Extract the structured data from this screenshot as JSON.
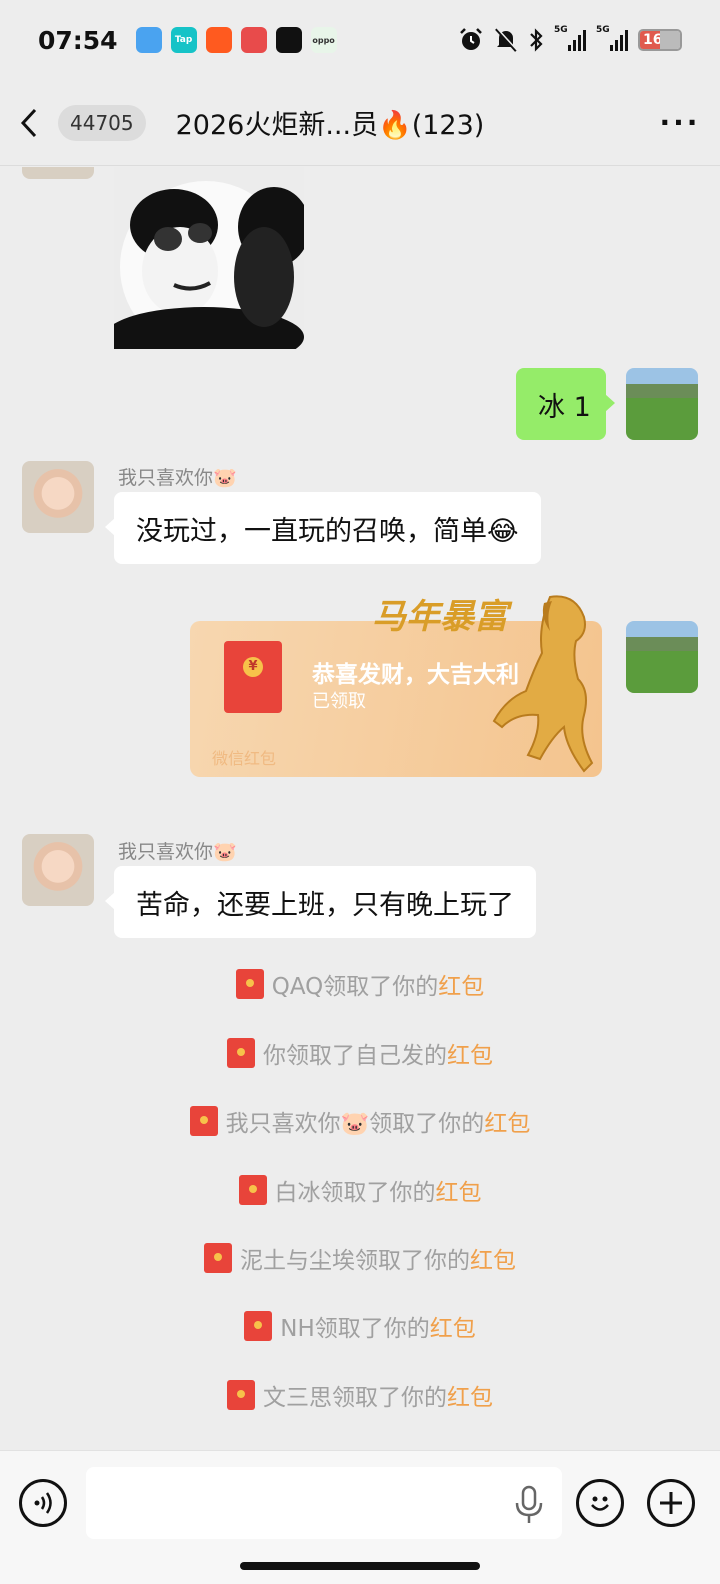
{
  "status": {
    "time": "07:54",
    "apps": [
      {
        "name": "paper-plane-app-icon",
        "label": "",
        "color": "#4aa3f0"
      },
      {
        "name": "taptap-app-icon",
        "label": "Tap",
        "color": "#16c3c7"
      },
      {
        "name": "kuaishou-app-icon",
        "label": "",
        "color": "#ff5a1f"
      },
      {
        "name": "game-app-icon",
        "label": "",
        "color": "#e84b4b"
      },
      {
        "name": "music-app-icon",
        "label": "",
        "color": "#111111"
      },
      {
        "name": "oppo-app-icon",
        "label": "oppo",
        "color": "#e8f5e9"
      }
    ],
    "signal1": "5G",
    "signal2": "5G",
    "battery": "16"
  },
  "nav": {
    "unread_count": "44705",
    "title": "2026火炬新...员🔥(123)",
    "more": "···"
  },
  "messages": {
    "outgoing_text": "冰 1",
    "sender_name": "我只喜欢你🐷",
    "msg1": "没玩过，一直玩的召唤，简单😂",
    "msg2": "苦命，还要上班，只有晚上玩了"
  },
  "red_packet": {
    "title": "恭喜发财，大吉大利",
    "status": "已领取",
    "footer": "微信红包",
    "banner": "马年暴富"
  },
  "system_messages": [
    {
      "prefix": "QAQ领取了你的",
      "link": "红包"
    },
    {
      "prefix": "你领取了自己发的",
      "link": "红包"
    },
    {
      "prefix": "我只喜欢你🐷领取了你的",
      "link": "红包"
    },
    {
      "prefix": "白冰领取了你的",
      "link": "红包"
    },
    {
      "prefix": "泥土与尘埃领取了你的",
      "link": "红包"
    },
    {
      "prefix": "NH领取了你的",
      "link": "红包"
    },
    {
      "prefix": "文三思领取了你的",
      "link": "红包"
    }
  ],
  "input": {
    "value": "",
    "placeholder": ""
  },
  "colors": {
    "accent_green": "#95ec69",
    "red_packet_link": "#f0a04b",
    "background": "#ededed"
  }
}
